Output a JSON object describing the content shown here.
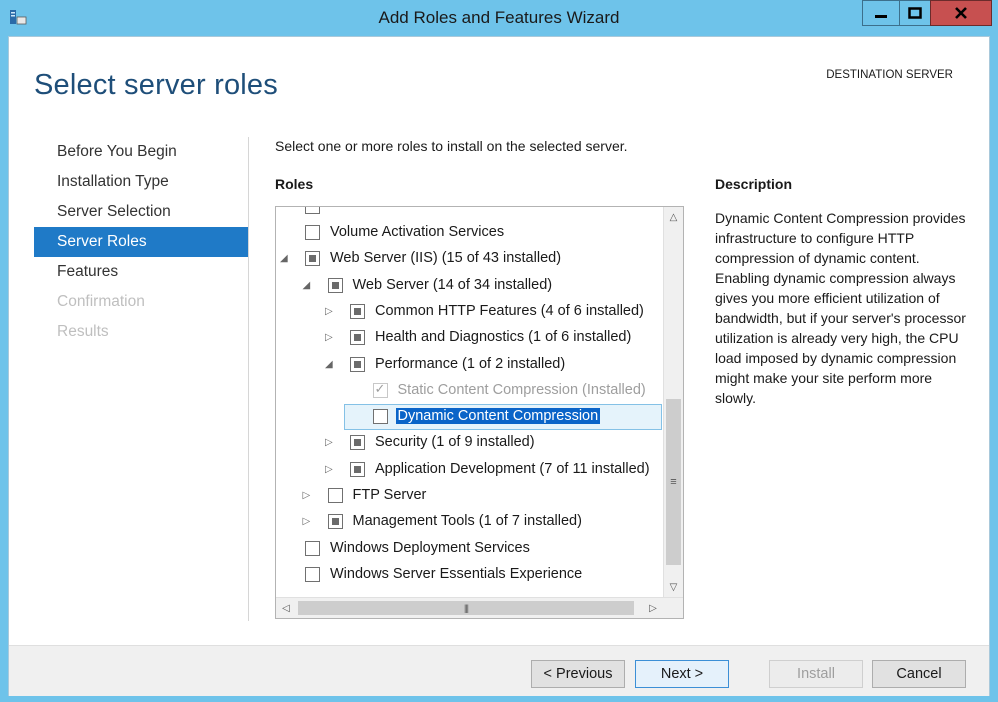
{
  "window": {
    "title": "Add Roles and Features Wizard"
  },
  "header": {
    "page_title": "Select server roles",
    "destination_label": "DESTINATION SERVER"
  },
  "nav": {
    "items": [
      {
        "label": "Before You Begin",
        "state": "normal"
      },
      {
        "label": "Installation Type",
        "state": "normal"
      },
      {
        "label": "Server Selection",
        "state": "normal"
      },
      {
        "label": "Server Roles",
        "state": "active"
      },
      {
        "label": "Features",
        "state": "normal"
      },
      {
        "label": "Confirmation",
        "state": "disabled"
      },
      {
        "label": "Results",
        "state": "disabled"
      }
    ]
  },
  "main": {
    "intro": "Select one or more roles to install on the selected server.",
    "roles_label": "Roles",
    "roles": [
      {
        "label": "Volume Activation Services",
        "level": 0,
        "expander": "none",
        "check": "unchecked"
      },
      {
        "label": "Web Server (IIS) (15 of 43 installed)",
        "level": 0,
        "expander": "expanded",
        "check": "partial"
      },
      {
        "label": "Web Server (14 of 34 installed)",
        "level": 1,
        "expander": "expanded",
        "check": "partial"
      },
      {
        "label": "Common HTTP Features (4 of 6 installed)",
        "level": 2,
        "expander": "collapsed",
        "check": "partial"
      },
      {
        "label": "Health and Diagnostics (1 of 6 installed)",
        "level": 2,
        "expander": "collapsed",
        "check": "partial"
      },
      {
        "label": "Performance (1 of 2 installed)",
        "level": 2,
        "expander": "expanded",
        "check": "partial"
      },
      {
        "label": "Static Content Compression (Installed)",
        "level": 3,
        "expander": "none",
        "check": "checked-disabled"
      },
      {
        "label": "Dynamic Content Compression",
        "level": 3,
        "expander": "none",
        "check": "unchecked",
        "selected": true
      },
      {
        "label": "Security (1 of 9 installed)",
        "level": 2,
        "expander": "collapsed",
        "check": "partial"
      },
      {
        "label": "Application Development (7 of 11 installed)",
        "level": 2,
        "expander": "collapsed",
        "check": "partial"
      },
      {
        "label": "FTP Server",
        "level": 1,
        "expander": "collapsed",
        "check": "unchecked"
      },
      {
        "label": "Management Tools (1 of 7 installed)",
        "level": 1,
        "expander": "collapsed",
        "check": "partial"
      },
      {
        "label": "Windows Deployment Services",
        "level": 0,
        "expander": "none",
        "check": "unchecked"
      },
      {
        "label": "Windows Server Essentials Experience",
        "level": 0,
        "expander": "none",
        "check": "unchecked"
      }
    ]
  },
  "description": {
    "label": "Description",
    "text": "Dynamic Content Compression provides infrastructure to configure HTTP compression of dynamic content. Enabling dynamic compression always gives you more efficient utilization of bandwidth, but if your server's processor utilization is already very high, the CPU load imposed by dynamic compression might make your site perform more slowly."
  },
  "footer": {
    "previous": "< Previous",
    "next": "Next >",
    "install": "Install",
    "cancel": "Cancel"
  }
}
